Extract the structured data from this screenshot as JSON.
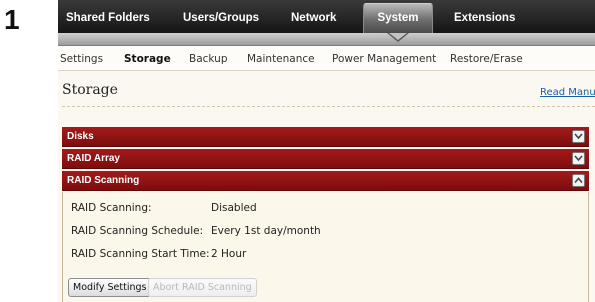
{
  "step_number": "1",
  "top_nav": {
    "items": [
      "Shared Folders",
      "Users/Groups",
      "Network",
      "System",
      "Extensions"
    ],
    "active": "System"
  },
  "sub_nav": {
    "items": [
      "Settings",
      "Storage",
      "Backup",
      "Maintenance",
      "Power Management",
      "Restore/Erase"
    ],
    "active": "Storage"
  },
  "page": {
    "title": "Storage",
    "read_manual_link": "Read Manual"
  },
  "panels": [
    {
      "label": "Disks",
      "expanded": false,
      "icon": "chevron-down-icon"
    },
    {
      "label": "RAID Array",
      "expanded": false,
      "icon": "chevron-down-icon"
    },
    {
      "label": "RAID Scanning",
      "expanded": true,
      "icon": "chevron-up-icon"
    }
  ],
  "raid_scanning": {
    "fields": [
      {
        "label": "RAID Scanning:",
        "value": "Disabled"
      },
      {
        "label": "RAID Scanning Schedule:",
        "value": "Every 1st day/month"
      },
      {
        "label": "RAID Scanning Start Time:",
        "value": "2 Hour"
      }
    ],
    "buttons": {
      "modify": "Modify Settings",
      "abort": "Abort RAID Scanning"
    }
  },
  "colors": {
    "panel_header": "#9a1515",
    "top_nav_bg": "#1f1f1f",
    "link": "#1a5fa8"
  }
}
